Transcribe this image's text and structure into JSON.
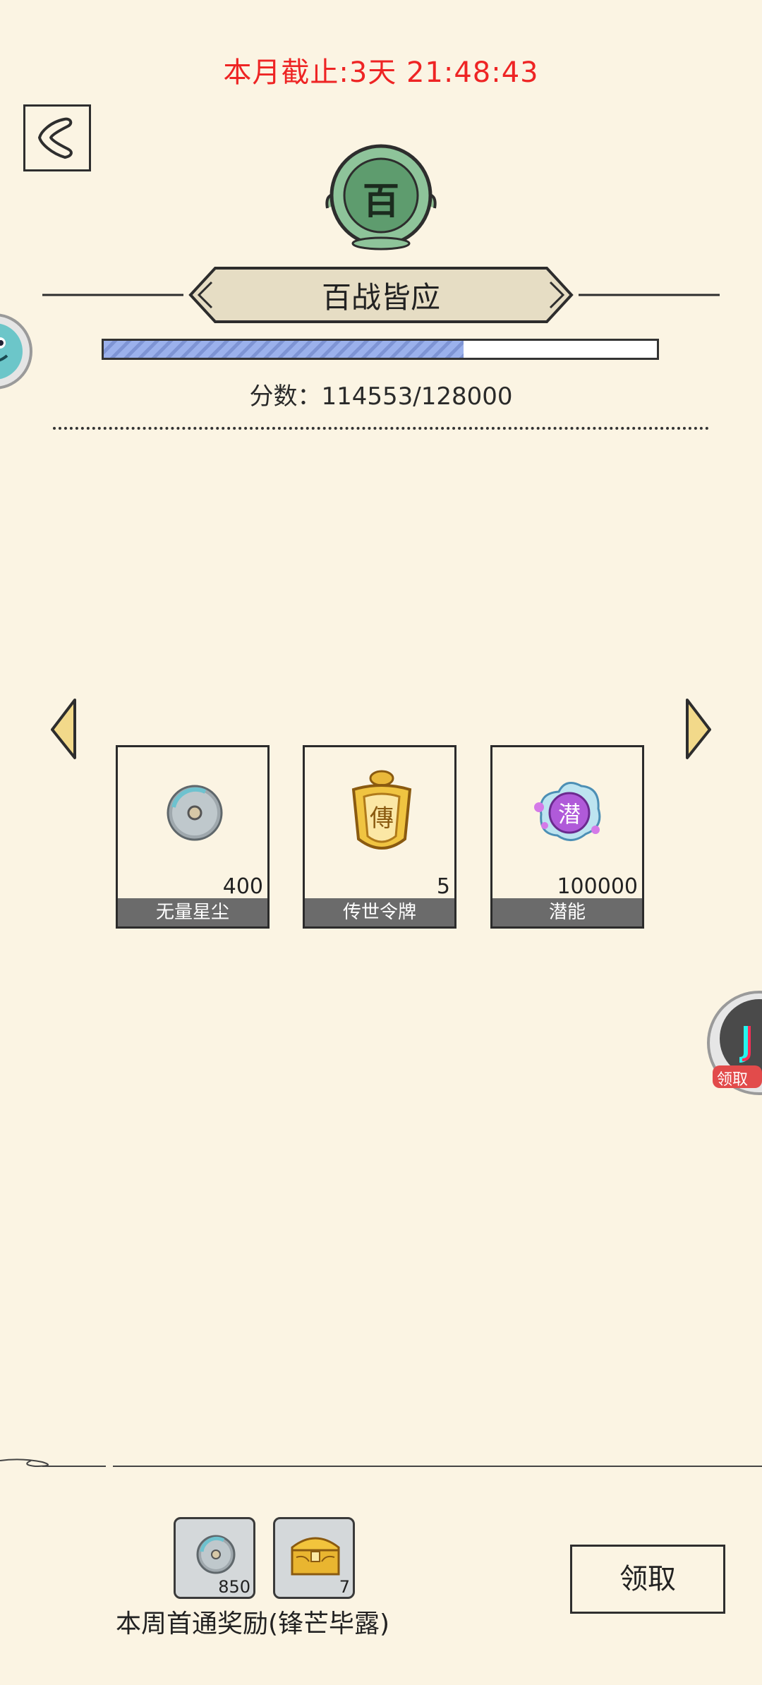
{
  "header": {
    "countdown": "本月截止:3天 21:48:43",
    "emblem_char": "百",
    "title": "百战皆应"
  },
  "progress": {
    "score_label": "分数：114553/128000",
    "fraction": 0.65
  },
  "rewards": [
    {
      "name": "无量星尘",
      "quantity": "400",
      "icon": "stardust-icon"
    },
    {
      "name": "传世令牌",
      "quantity": "5",
      "icon": "heirloom-token-icon"
    },
    {
      "name": "潜能",
      "quantity": "100000",
      "icon": "potential-orb-icon",
      "icon_char": "潜"
    }
  ],
  "weekly": {
    "label": "本周首通奖励(锋芒毕露)",
    "items": [
      {
        "quantity": "850",
        "icon": "stardust-icon"
      },
      {
        "quantity": "7",
        "icon": "treasure-chest-icon"
      }
    ],
    "claim_label": "领取"
  },
  "side_widgets": {
    "right_label": "领取"
  },
  "colors": {
    "background": "#fbf4e3",
    "countdown": "#ee2424",
    "progress_fill": "#9bb1ec",
    "emblem_green": "#5e9c6e"
  }
}
